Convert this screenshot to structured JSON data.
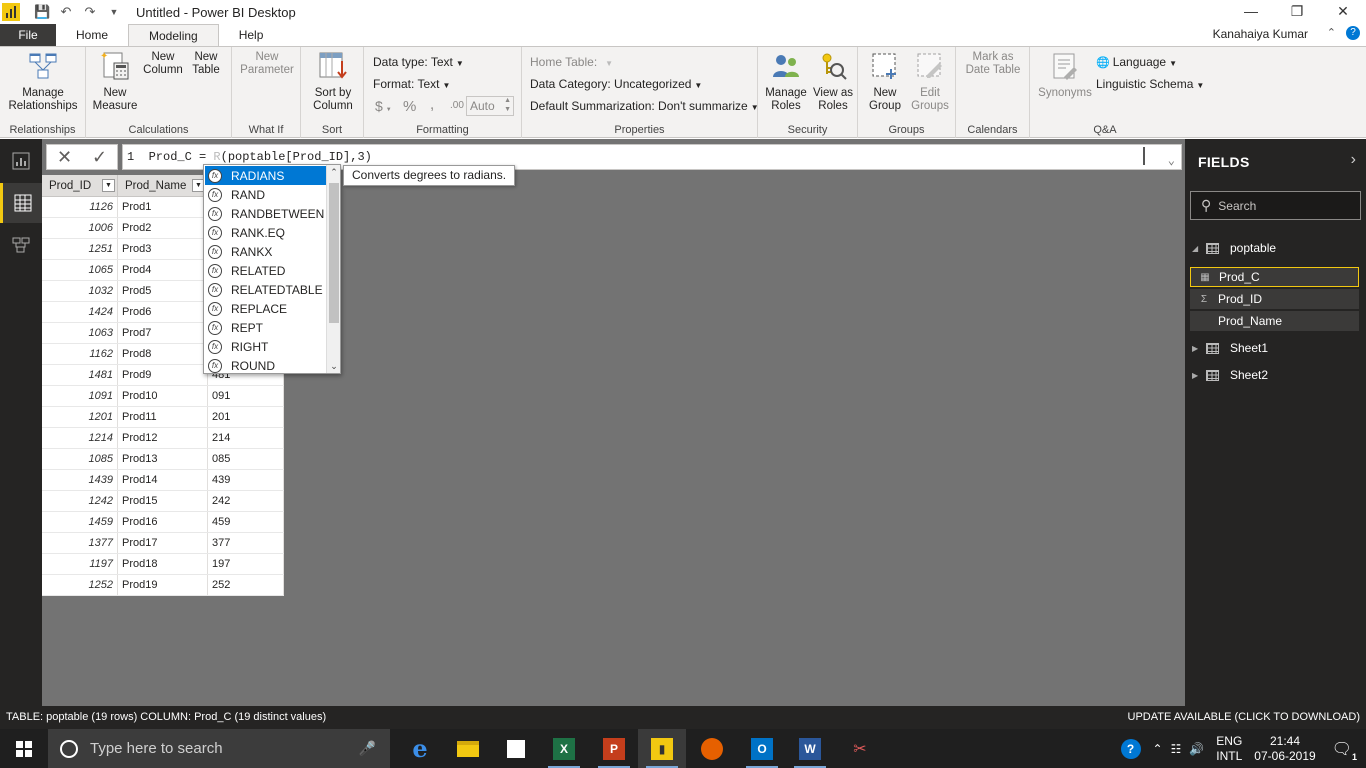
{
  "window": {
    "title": "Untitled - Power BI Desktop",
    "user": "Kanahaiya Kumar"
  },
  "tabs": {
    "file": "File",
    "items": [
      "Home",
      "Modeling",
      "Help"
    ],
    "active": "Modeling"
  },
  "ribbon": {
    "relationships": {
      "manage": "Manage\nRelationships",
      "group": "Relationships"
    },
    "calculations": {
      "new_measure": "New\nMeasure",
      "new_column": "New\nColumn",
      "new_table": "New\nTable",
      "group": "Calculations"
    },
    "whatif": {
      "new_parameter": "New\nParameter",
      "group": "What If"
    },
    "sort": {
      "sort_by_column": "Sort by\nColumn",
      "group": "Sort"
    },
    "formatting": {
      "data_type": "Data type: Text",
      "format": "Format: Text",
      "currency": "$",
      "percent": "%",
      "comma": ",",
      "decimals": ".00",
      "auto": "Auto",
      "group": "Formatting"
    },
    "properties": {
      "home_table": "Home Table:",
      "data_category": "Data Category: Uncategorized",
      "summarization": "Default Summarization: Don't summarize",
      "group": "Properties"
    },
    "security": {
      "manage_roles": "Manage\nRoles",
      "view_as_roles": "View as\nRoles",
      "group": "Security"
    },
    "groups": {
      "new_group": "New\nGroup",
      "edit_groups": "Edit\nGroups",
      "group": "Groups"
    },
    "calendars": {
      "mark_as_date_table": "Mark as\nDate Table",
      "group": "Calendars"
    },
    "qa": {
      "synonyms": "Synonyms",
      "language": "Language",
      "linguistic_schema": "Linguistic Schema",
      "group": "Q&A"
    }
  },
  "formula": {
    "line": "1",
    "text_before": "Prod_C = ",
    "text_dim": "R",
    "text_after": "(poptable[Prod_ID],3)"
  },
  "grid": {
    "headers": [
      "Prod_ID",
      "Prod_Name",
      ""
    ],
    "rows": [
      [
        "1126",
        "Prod1",
        ""
      ],
      [
        "1006",
        "Prod2",
        ""
      ],
      [
        "1251",
        "Prod3",
        ""
      ],
      [
        "1065",
        "Prod4",
        ""
      ],
      [
        "1032",
        "Prod5",
        ""
      ],
      [
        "1424",
        "Prod6",
        ""
      ],
      [
        "1063",
        "Prod7",
        ""
      ],
      [
        "1162",
        "Prod8",
        ""
      ],
      [
        "1481",
        "Prod9",
        "481"
      ],
      [
        "1091",
        "Prod10",
        "091"
      ],
      [
        "1201",
        "Prod11",
        "201"
      ],
      [
        "1214",
        "Prod12",
        "214"
      ],
      [
        "1085",
        "Prod13",
        "085"
      ],
      [
        "1439",
        "Prod14",
        "439"
      ],
      [
        "1242",
        "Prod15",
        "242"
      ],
      [
        "1459",
        "Prod16",
        "459"
      ],
      [
        "1377",
        "Prod17",
        "377"
      ],
      [
        "1197",
        "Prod18",
        "197"
      ],
      [
        "1252",
        "Prod19",
        "252"
      ]
    ]
  },
  "autocomplete": {
    "items": [
      "RADIANS",
      "RAND",
      "RANDBETWEEN",
      "RANK.EQ",
      "RANKX",
      "RELATED",
      "RELATEDTABLE",
      "REPLACE",
      "REPT",
      "RIGHT",
      "ROUND"
    ],
    "selected": "RADIANS",
    "tooltip": "Converts degrees to radians."
  },
  "fields_pane": {
    "title": "FIELDS",
    "search_placeholder": "Search",
    "tables": [
      {
        "name": "poptable",
        "expanded": true,
        "fields": [
          {
            "name": "Prod_C",
            "icon": "calc-column-icon",
            "selected": true
          },
          {
            "name": "Prod_ID",
            "icon": "sigma-icon",
            "selected": false
          },
          {
            "name": "Prod_Name",
            "icon": "",
            "selected": false
          }
        ]
      },
      {
        "name": "Sheet1",
        "expanded": false
      },
      {
        "name": "Sheet2",
        "expanded": false
      }
    ]
  },
  "status": {
    "left": "TABLE: poptable (19 rows) COLUMN: Prod_C (19 distinct values)",
    "right": "UPDATE AVAILABLE (CLICK TO DOWNLOAD)"
  },
  "taskbar": {
    "search_placeholder": "Type here to search",
    "lang_top": "ENG",
    "lang_bottom": "INTL",
    "time": "21:44",
    "date": "07-06-2019",
    "notification_count": "1"
  },
  "colors": {
    "accent": "#f2c811",
    "selection": "#0078d4",
    "canvas": "#737373",
    "dark_pane": "#252423"
  }
}
